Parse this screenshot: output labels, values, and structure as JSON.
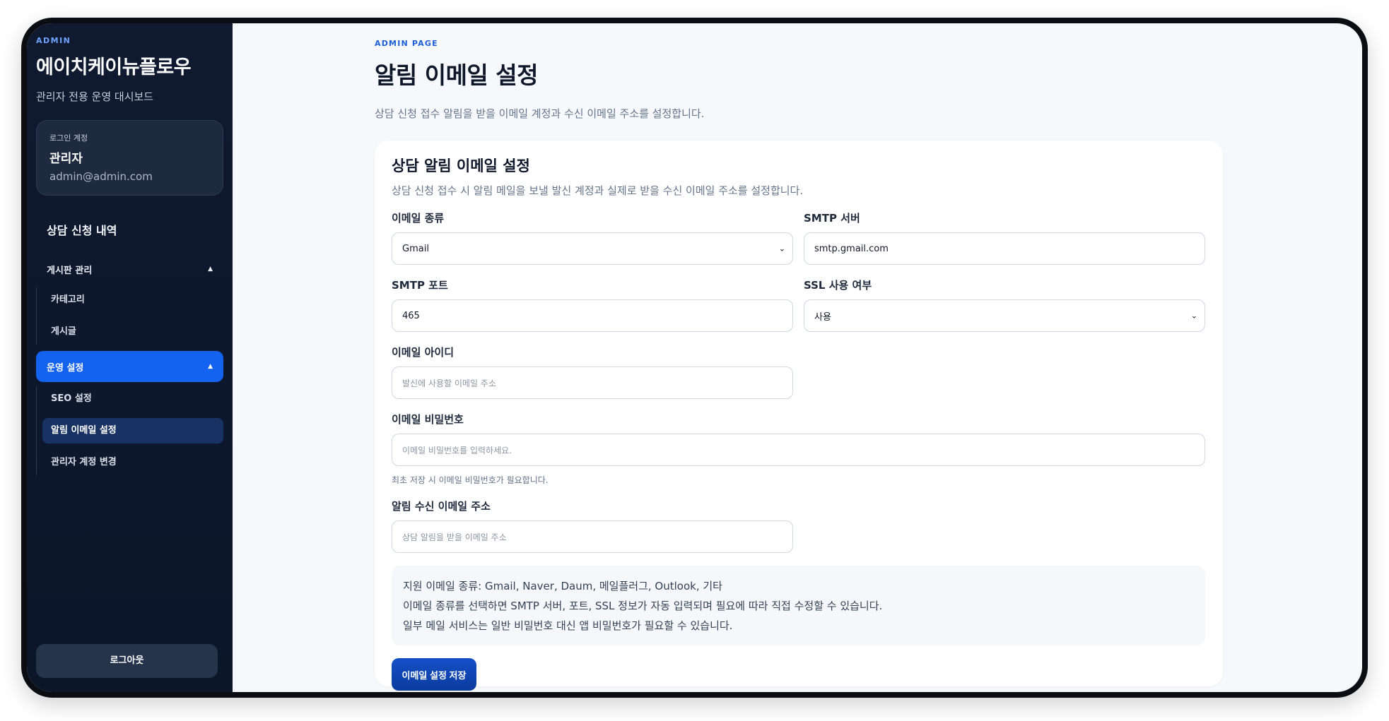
{
  "sidebar": {
    "eyebrow": "ADMIN",
    "brand": "에이치케이뉴플로우",
    "subtitle": "관리자 전용 운영 대시보드",
    "account": {
      "label": "로그인 계정",
      "name": "관리자",
      "email": "admin@admin.com"
    },
    "nav_top": "상담 신청 내역",
    "groups": [
      {
        "label": "게시판 관리",
        "caret": "▲",
        "items": [
          "카테고리",
          "게시글"
        ]
      },
      {
        "label": "운영 설정",
        "caret": "▲",
        "items": [
          "SEO 설정",
          "알림 이메일 설정",
          "관리자 계정 변경"
        ]
      }
    ],
    "logout": "로그아웃"
  },
  "main": {
    "eyebrow": "ADMIN PAGE",
    "title": "알림 이메일 설정",
    "description": "상담 신청 접수 알림을 받을 이메일 계정과 수신 이메일 주소를 설정합니다.",
    "card": {
      "title": "상담 알림 이메일 설정",
      "description": "상담 신청 접수 시 알림 메일을 보낼 발신 계정과 실제로 받을 수신 이메일 주소를 설정합니다.",
      "email_type": {
        "label": "이메일 종류",
        "value": "Gmail"
      },
      "smtp_server": {
        "label": "SMTP 서버",
        "value": "smtp.gmail.com"
      },
      "smtp_port": {
        "label": "SMTP 포트",
        "value": "465"
      },
      "ssl": {
        "label": "SSL 사용 여부",
        "value": "사용"
      },
      "email_id": {
        "label": "이메일 아이디",
        "placeholder": "발신에 사용할 이메일 주소"
      },
      "email_password": {
        "label": "이메일 비밀번호",
        "placeholder": "이메일 비밀번호를 입력하세요.",
        "hint": "최초 저장 시 이메일 비밀번호가 필요합니다."
      },
      "recipient": {
        "label": "알림 수신 이메일 주소",
        "placeholder": "상담 알림을 받을 이메일 주소"
      },
      "info_lines": [
        "지원 이메일 종류: Gmail, Naver, Daum, 메일플러그, Outlook, 기타",
        "이메일 종류를 선택하면 SMTP 서버, 포트, SSL 정보가 자동 입력되며 필요에 따라 직접 수정할 수 있습니다.",
        "일부 메일 서비스는 일반 비밀번호 대신 앱 비밀번호가 필요할 수 있습니다."
      ],
      "save_label": "이메일 설정 저장"
    }
  },
  "icons": {
    "select_arrow": "chevron-down-icon",
    "group_caret": "caret-up-icon"
  },
  "colors": {
    "accent": "#1463f0",
    "sidebar_bg": "#0f1a30",
    "primary_button": "#0b3b9e"
  }
}
